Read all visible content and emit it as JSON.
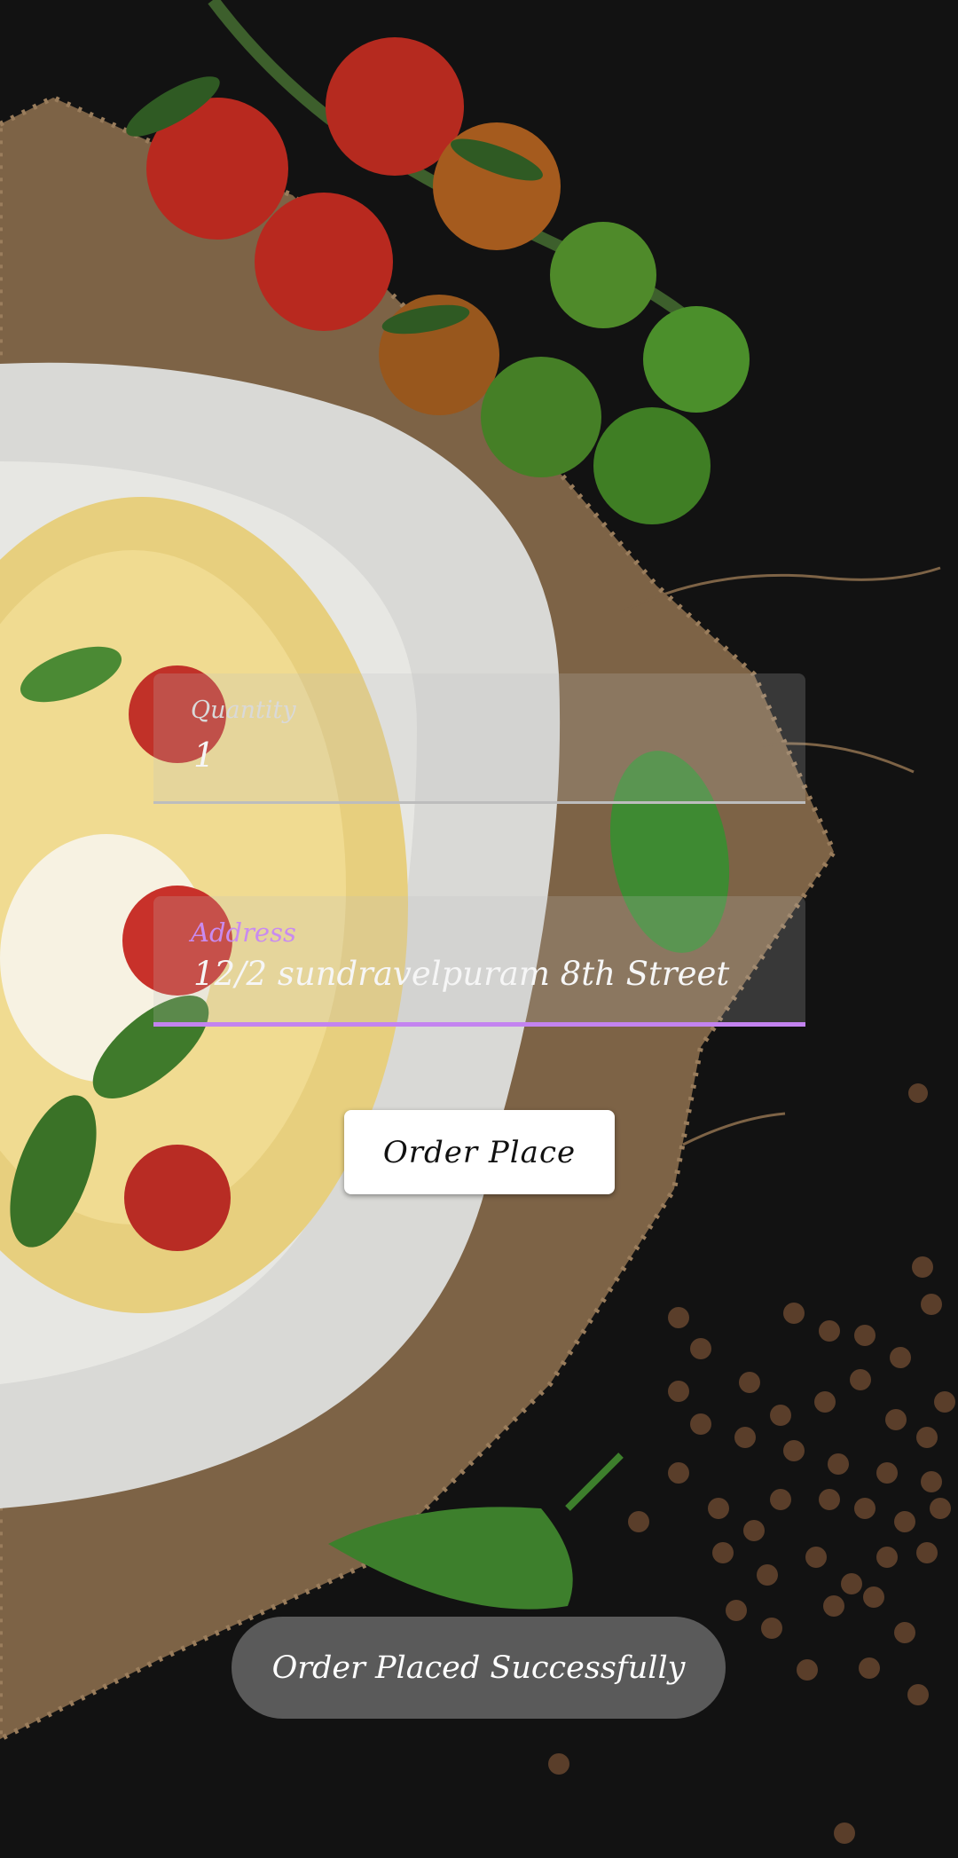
{
  "quantity": {
    "label": "Quantity",
    "value": "1"
  },
  "address": {
    "label": "Address",
    "value": "12/2 sundravelpuram 8th Street"
  },
  "order_button": {
    "label": "Order Place"
  },
  "toast": {
    "message": "Order Placed Successfully"
  },
  "colors": {
    "background": "#121212",
    "accent": "#c383f0",
    "button_bg": "#ffffff",
    "toast_bg": "#5a5a5a"
  },
  "background_image": "spaghetti-plate-with-tomatoes-basil-and-peppercorns"
}
